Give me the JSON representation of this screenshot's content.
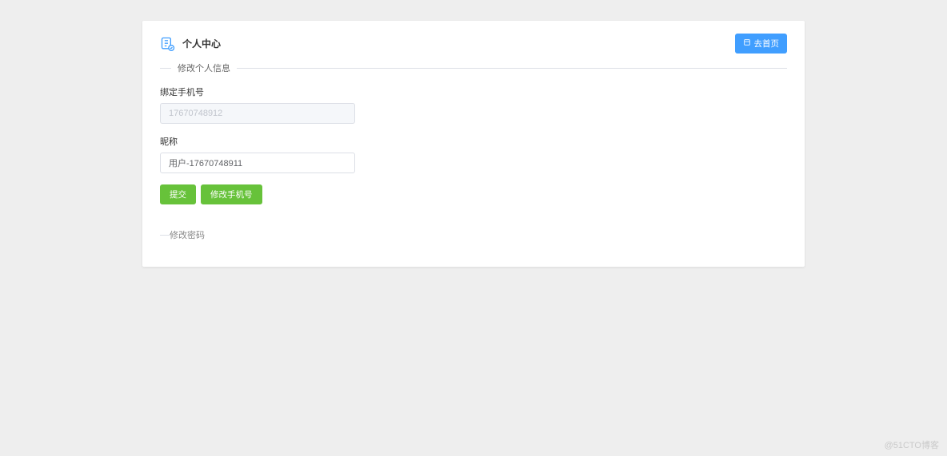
{
  "header": {
    "title": "个人中心",
    "home_button": "去首页"
  },
  "sections": {
    "edit_profile_label": "修改个人信息",
    "change_password_label": "修改密码"
  },
  "form": {
    "phone_label": "绑定手机号",
    "phone_value": "17670748912",
    "nickname_label": "昵称",
    "nickname_value": "用户-17670748911"
  },
  "buttons": {
    "submit": "提交",
    "change_phone": "修改手机号"
  },
  "watermark": "@51CTO博客"
}
